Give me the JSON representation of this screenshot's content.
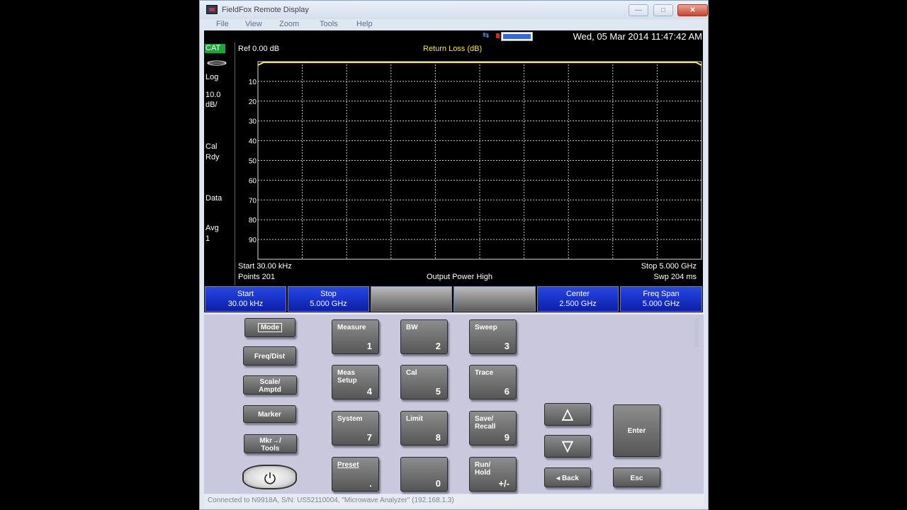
{
  "window": {
    "title": "FieldFox Remote Display",
    "min": "—",
    "max": "□",
    "close": "✕"
  },
  "menu": [
    "File",
    "View",
    "Zoom",
    "Tools",
    "Help"
  ],
  "status": {
    "datetime": "Wed, 05 Mar 2014 11:47:42 AM"
  },
  "left_panel": {
    "mode": "CAT",
    "scale_type": "Log",
    "scale_value_1": "10.0",
    "scale_value_2": "dB/",
    "cal_1": "Cal",
    "cal_2": "Rdy",
    "data": "Data",
    "avg_1": "Avg",
    "avg_2": "1"
  },
  "plot": {
    "ref": "Ref 0.00 dB",
    "format": "Return Loss (dB)",
    "y_ticks": [
      "10",
      "20",
      "30",
      "40",
      "50",
      "60",
      "70",
      "80",
      "90"
    ],
    "trace_color": "#f4e84a"
  },
  "freq_info": {
    "start": "Start 30.00 kHz",
    "points": "Points 201",
    "power": "Output Power High",
    "stop": "Stop 5.000 GHz",
    "sweep": "Swp 204 ms"
  },
  "softkeys": [
    {
      "l1": "Start",
      "l2": "30.00 kHz",
      "style": "blue"
    },
    {
      "l1": "Stop",
      "l2": "5.000 GHz",
      "style": "blue"
    },
    {
      "l1": "",
      "l2": "",
      "style": "grey"
    },
    {
      "l1": "",
      "l2": "",
      "style": "grey"
    },
    {
      "l1": "Center",
      "l2": "2.500 GHz",
      "style": "blue"
    },
    {
      "l1": "Freq Span",
      "l2": "5.000 GHz",
      "style": "blue"
    }
  ],
  "side_keys": [
    "Mode",
    "Freq/Dist",
    "Scale/\nAmptd",
    "Marker",
    "Mkr→/\nTools"
  ],
  "num_keys": [
    {
      "label": "Measure",
      "num": "1"
    },
    {
      "label": "BW",
      "num": "2"
    },
    {
      "label": "Sweep",
      "num": "3"
    },
    {
      "label": "Meas\nSetup",
      "num": "4"
    },
    {
      "label": "Cal",
      "num": "5"
    },
    {
      "label": "Trace",
      "num": "6"
    },
    {
      "label": "System",
      "num": "7"
    },
    {
      "label": "Limit",
      "num": "8"
    },
    {
      "label": "Save/\nRecall",
      "num": "9"
    },
    {
      "label": "Preset",
      "num": "."
    },
    {
      "label": "",
      "num": "0"
    },
    {
      "label": "Run/\nHold",
      "num": "+/-"
    }
  ],
  "nav_keys": {
    "up": "△",
    "down": "▽",
    "back": "◂ Back",
    "enter": "Enter",
    "esc": "Esc"
  },
  "statusbar": "Connected to N9918A, S/N: US52110004, \"Microwave Analyzer\" (192.168.1.3)"
}
